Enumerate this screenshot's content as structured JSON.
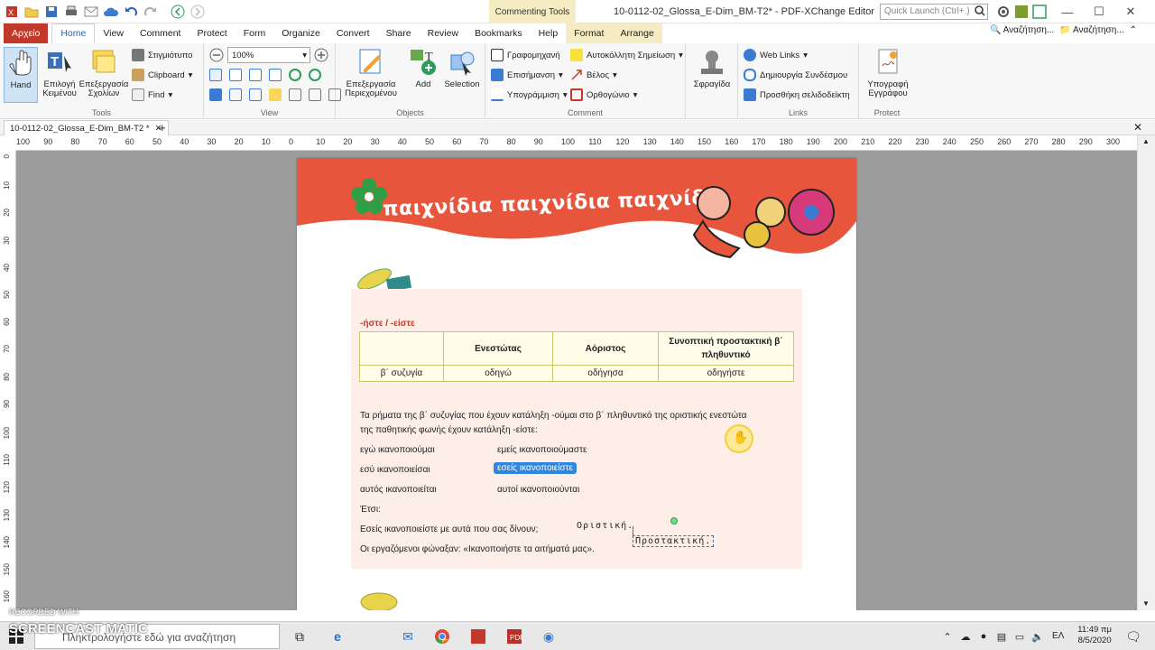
{
  "window": {
    "title": "10-0112-02_Glossa_E-Dim_BM-T2* - PDF-XChange Editor",
    "context_group": "Commenting Tools",
    "quick_launch_placeholder": "Quick Launch (Ctrl+.)"
  },
  "menu_tabs": [
    "Αρχείο",
    "Home",
    "View",
    "Comment",
    "Protect",
    "Form",
    "Organize",
    "Convert",
    "Share",
    "Review",
    "Bookmarks",
    "Help",
    "Format",
    "Arrange"
  ],
  "search_buttons": [
    "Αναζήτηση...",
    "Αναζήτηση..."
  ],
  "ribbon": {
    "tools": {
      "hand": "Hand",
      "select_text": "Επιλογή Κειμένου",
      "edit_comments": "Επεξεργασία Σχολίων",
      "snapshot": "Στιγμιότυπο",
      "clipboard": "Clipboard",
      "find": "Find",
      "group": "Tools"
    },
    "view": {
      "zoom": "100%",
      "group": "View"
    },
    "objects": {
      "edit_content": "Επεξεργασία Περιεχομένου",
      "add": "Add",
      "selection": "Selection",
      "group": "Objects"
    },
    "comment": {
      "typewriter": "Γραφομηχανή",
      "highlight": "Επισήμανση",
      "underline": "Υπογράμμιση",
      "sticky": "Αυτοκόλλητη Σημείωση",
      "arrow": "Βέλος",
      "rectangle": "Ορθογώνιο",
      "group": "Comment"
    },
    "stamp": {
      "label": "Σφραγίδα"
    },
    "links": {
      "web_links": "Web Links",
      "create_link": "Δημιουργία Συνδέσμου",
      "add_bookmark": "Προσθήκη σελιδοδείκτη",
      "group": "Links"
    },
    "protect": {
      "sign": "Υπογραφή Εγγράφου",
      "group": "Protect"
    }
  },
  "doc_tab": "10-0112-02_Glossa_E-Dim_BM-T2 *",
  "ruler_h": [
    "100",
    "90",
    "80",
    "70",
    "60",
    "50",
    "40",
    "30",
    "20",
    "10",
    "0",
    "10",
    "20",
    "30",
    "40",
    "50",
    "60",
    "70",
    "80",
    "90",
    "100",
    "110",
    "120",
    "130",
    "140",
    "150",
    "160",
    "170",
    "180",
    "190",
    "200",
    "210",
    "220",
    "230",
    "240",
    "250",
    "260",
    "270",
    "280",
    "290",
    "300"
  ],
  "ruler_v": [
    "0",
    "10",
    "20",
    "30",
    "40",
    "50",
    "60",
    "70",
    "80",
    "90",
    "100",
    "110",
    "120",
    "130",
    "140",
    "150",
    "160"
  ],
  "page": {
    "banner": "παιχνίδια  παιχνίδια  παιχνίδια",
    "section_heading": "-ήστε / -είστε",
    "table": {
      "header": [
        "",
        "Ενεστώτας",
        "Αόριστος",
        "Συνοπτική προστακτική β΄ πληθυντικό"
      ],
      "row": [
        "β΄ συζυγία",
        "οδηγώ",
        "οδήγησα",
        "οδηγήστε"
      ]
    },
    "paragraph_line1": "Τα ρήματα της β΄ συζυγίας που έχουν κατάληξη -ούμαι στο β΄ πληθυντικό της οριστικής ενεστώτα",
    "paragraph_line2": "της παθητικής φωνής έχουν κατάληξη -είστε:",
    "conj": [
      [
        "εγώ ικανοποιούμαι",
        "εμείς ικανοποιούμαστε"
      ],
      [
        "εσύ ικανοποιείσαι",
        "εσείς ικανοποιείστε"
      ],
      [
        "αυτός ικανοποιείται",
        "αυτοί ικανοποιούνται"
      ]
    ],
    "etsi": "Έτσι:",
    "ex1": "Εσείς ικανοποιείστε με αυτά που σας δίνουν;",
    "ex2": "Οι εργαζόμενοι φώναξαν: «Ικανοποιήστε τα αιτήματά μας».",
    "note1": "Οριστική.",
    "note2": "Προστακτική."
  },
  "taskbar": {
    "search_placeholder": "Πληκτρολογήστε εδώ για αναζήτηση",
    "lang": "ΕΛ",
    "time": "11:49 πμ",
    "date": "8/5/2020"
  },
  "watermark": {
    "line1": "RECORDED WITH",
    "line2": "SCREENCAST MATIC"
  },
  "colors": {
    "banner": "#e8553d",
    "file_tab": "#c0392b",
    "highlight": "#2e86de",
    "box": "#fdeee7"
  }
}
